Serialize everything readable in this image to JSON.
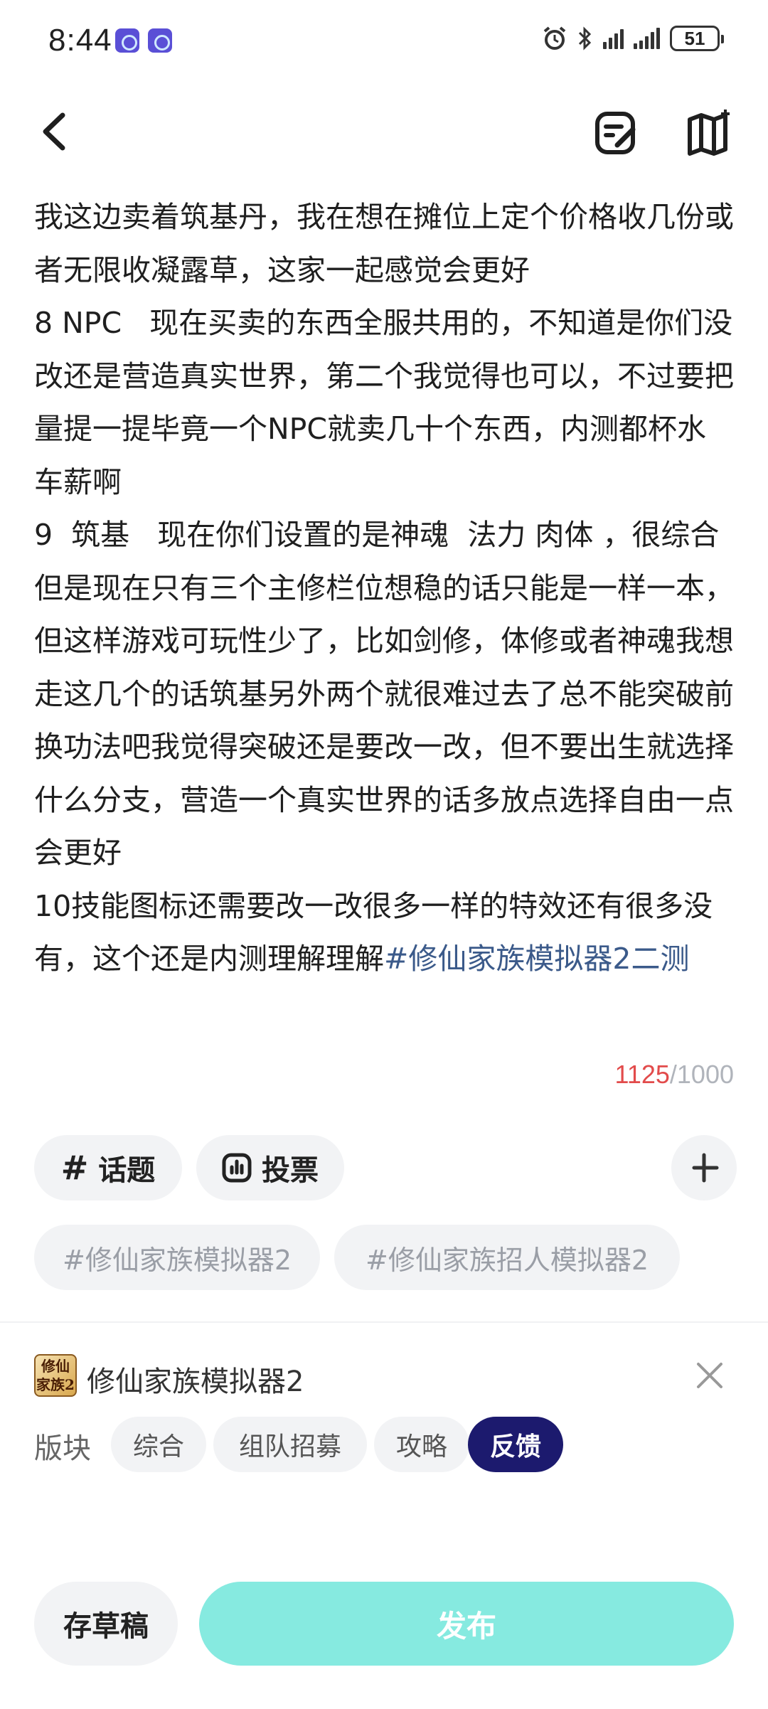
{
  "status_bar": {
    "time": "8:44",
    "battery": "51"
  },
  "post": {
    "body_text": "我这边卖着筑基丹，我在想在摊位上定个价格收几份或者无限收凝露草，这家一起感觉会更好\n8 NPC   现在买卖的东西全服共用的，不知道是你们没改还是营造真实世界，第二个我觉得也可以，不过要把量提一提毕竟一个NPC就卖几十个东西，内测都杯水车薪啊\n9  筑基   现在你们设置的是神魂  法力 肉体 ，很综合但是现在只有三个主修栏位想稳的话只能是一样一本，但这样游戏可玩性少了，比如剑修，体修或者神魂我想走这几个的话筑基另外两个就很难过去了总不能突破前换功法吧我觉得突破还是要改一改，但不要出生就选择什么分支，营造一个真实世界的话多放点选择自由一点会更好\n10技能图标还需要改一改很多一样的特效还有很多没有，这个还是内测理解理解",
    "hashtag": "#修仙家族模拟器2二测",
    "char_count": "1125",
    "char_limit": "/1000"
  },
  "tools": {
    "topic_label": "话题",
    "vote_label": "投票"
  },
  "suggested_tags": [
    "#修仙家族模拟器2",
    "#修仙家族招人模拟器2"
  ],
  "game": {
    "name": "修仙家族模拟器2",
    "logo_text_1": "修仙",
    "logo_text_2": "家族2"
  },
  "section": {
    "label": "版块",
    "options": [
      "综合",
      "组队招募",
      "攻略",
      "反馈"
    ],
    "selected": "反馈"
  },
  "actions": {
    "save_draft": "存草稿",
    "publish": "发布"
  },
  "colors": {
    "hashtag": "#3b5a8a",
    "over_limit": "#e24b4b",
    "selected_section": "#1c1a6e",
    "publish_button": "#86eae0"
  }
}
